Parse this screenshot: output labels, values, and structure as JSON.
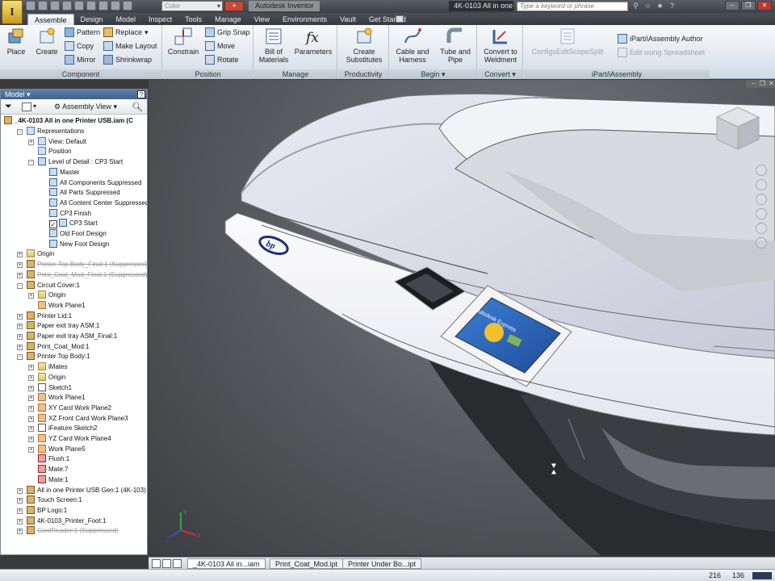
{
  "titlebar": {
    "app_menu_glyph": "I",
    "color_combo_value": "Color",
    "app_title": "Autodesk Inventor",
    "doc_title": "4K-0103 All in one",
    "search_placeholder": "Type a keyword or phrase",
    "window_buttons": [
      "–",
      "❐",
      "✕"
    ]
  },
  "tabs": [
    "Assemble",
    "Design",
    "Model",
    "Inspect",
    "Tools",
    "Manage",
    "View",
    "Environments",
    "Vault",
    "Get Started"
  ],
  "active_tab": "Assemble",
  "ribbon": {
    "component": {
      "label": "Component",
      "place": "Place",
      "create": "Create",
      "pattern": "Pattern",
      "copy": "Copy",
      "mirror": "Mirror",
      "replace": "Replace",
      "make_layout": "Make Layout",
      "shrinkwrap": "Shrinkwrap"
    },
    "position": {
      "label": "Position",
      "constrain": "Constrain",
      "grip_snap": "Grip Snap",
      "move": "Move",
      "rotate": "Rotate"
    },
    "manage": {
      "label": "Manage",
      "bom_line1": "Bill of",
      "bom_line2": "Materials",
      "parameters": "Parameters"
    },
    "productivity": {
      "label": "Productivity",
      "line1": "Create",
      "line2": "Substitutes"
    },
    "begin": {
      "label": "Begin",
      "cable_line1": "Cable and",
      "cable_line2": "Harness",
      "tube_line1": "Tube and",
      "tube_line2": "Pipe"
    },
    "convert": {
      "label": "Convert",
      "line1": "Convert to",
      "line2": "Weldment"
    },
    "ipart": {
      "label": "iPart/iAssembly",
      "configs": "ConfigsEditScopeSplit",
      "author": "iPart/iAssembly Author",
      "spreadsheet": "Edit using Spreadsheet"
    }
  },
  "browser": {
    "title": "Model",
    "help": "?",
    "view_combo": "Assembly View",
    "root": "_4K-0103 All in one Printer USB.iam (C",
    "nodes": [
      {
        "label": "Representations",
        "icon": "rep",
        "exp": "-"
      },
      {
        "label": "View: Default",
        "icon": "rep",
        "exp": "+"
      },
      {
        "label": "Position",
        "icon": "rep",
        "exp": ""
      },
      {
        "label": "Level of Detail : CP3 Start",
        "icon": "lod",
        "exp": "-"
      },
      {
        "label": "Master",
        "icon": "lod",
        "exp": ""
      },
      {
        "label": "All Components Suppressed",
        "icon": "lod",
        "exp": ""
      },
      {
        "label": "All Parts Suppressed",
        "icon": "lod",
        "exp": ""
      },
      {
        "label": "All Content Center Suppressed",
        "icon": "lod",
        "exp": ""
      },
      {
        "label": "CP3 Finish",
        "icon": "lod",
        "exp": ""
      },
      {
        "label": "CP3 Start",
        "icon": "lod",
        "exp": "",
        "checked": true
      },
      {
        "label": "Old Foot Design",
        "icon": "lod",
        "exp": ""
      },
      {
        "label": "New Foot Design",
        "icon": "lod",
        "exp": ""
      },
      {
        "label": "Origin",
        "icon": "folder",
        "exp": "+"
      },
      {
        "label": "Printer Top Body_Final:1 (Suppressed)",
        "icon": "part",
        "exp": "+",
        "suppressed": true
      },
      {
        "label": "Print_Coat_Mod_Final:1 (Suppressed)",
        "icon": "part",
        "exp": "+",
        "suppressed": true
      },
      {
        "label": "Circuit Cover:1",
        "icon": "part",
        "exp": "-"
      },
      {
        "label": "Origin",
        "icon": "folder",
        "exp": "+"
      },
      {
        "label": "Work Plane1",
        "icon": "plane",
        "exp": ""
      },
      {
        "label": "Printer Lid:1",
        "icon": "part",
        "exp": "+"
      },
      {
        "label": "Paper exit tray ASM:1",
        "icon": "part",
        "exp": "+"
      },
      {
        "label": "Paper exit tray ASM_Final:1",
        "icon": "part",
        "exp": "+"
      },
      {
        "label": "Print_Coat_Mod:1",
        "icon": "part",
        "exp": "+"
      },
      {
        "label": "Printer Top Body:1",
        "icon": "part",
        "exp": "-"
      },
      {
        "label": "iMates",
        "icon": "folder",
        "exp": "+"
      },
      {
        "label": "Origin",
        "icon": "folder",
        "exp": "+"
      },
      {
        "label": "Sketch1",
        "icon": "sketch",
        "exp": "+"
      },
      {
        "label": "Work Plane1",
        "icon": "plane",
        "exp": "+"
      },
      {
        "label": "XY Card Work Plane2",
        "icon": "plane",
        "exp": "+"
      },
      {
        "label": "XZ Front Card Work Plane3",
        "icon": "plane",
        "exp": "+"
      },
      {
        "label": "iFeature Sketch2",
        "icon": "sketch",
        "exp": "+"
      },
      {
        "label": "YZ Card Work Plane4",
        "icon": "plane",
        "exp": "+"
      },
      {
        "label": "Work Plane5",
        "icon": "plane",
        "exp": "+"
      },
      {
        "label": "Flush:1",
        "icon": "constraint",
        "exp": ""
      },
      {
        "label": "Mate:7",
        "icon": "constraint",
        "exp": ""
      },
      {
        "label": "Mate:1",
        "icon": "constraint",
        "exp": ""
      },
      {
        "label": "All in one Printer USB Gen:1 (4K-103)",
        "icon": "part",
        "exp": "+"
      },
      {
        "label": "Touch Screen:1",
        "icon": "part",
        "exp": "+"
      },
      {
        "label": "BP Logo:1",
        "icon": "part",
        "exp": "+"
      },
      {
        "label": "4K-0103_Printer_Foot:1",
        "icon": "part",
        "exp": "+"
      },
      {
        "label": "CardReader:1 (Suppressed)",
        "icon": "part",
        "exp": "+",
        "suppressed": true
      }
    ]
  },
  "viewport": {
    "screen_title": "Autodesk Express",
    "logo_text": "bp",
    "triad": {
      "x": "X",
      "y": "Y",
      "z": "Z"
    }
  },
  "doc_tabs": [
    "_4K-0103 All in...iam",
    "Print_Coat_Mod.ipt",
    "Printer Under Bo...ipt"
  ],
  "active_doc_tab": 0,
  "status": {
    "value_1": "216",
    "value_2": "136"
  },
  "colors": {
    "ribbon_blue": "#3f6290",
    "tab_active": "#ffffff",
    "viewport_bg": "#5a5d61"
  }
}
